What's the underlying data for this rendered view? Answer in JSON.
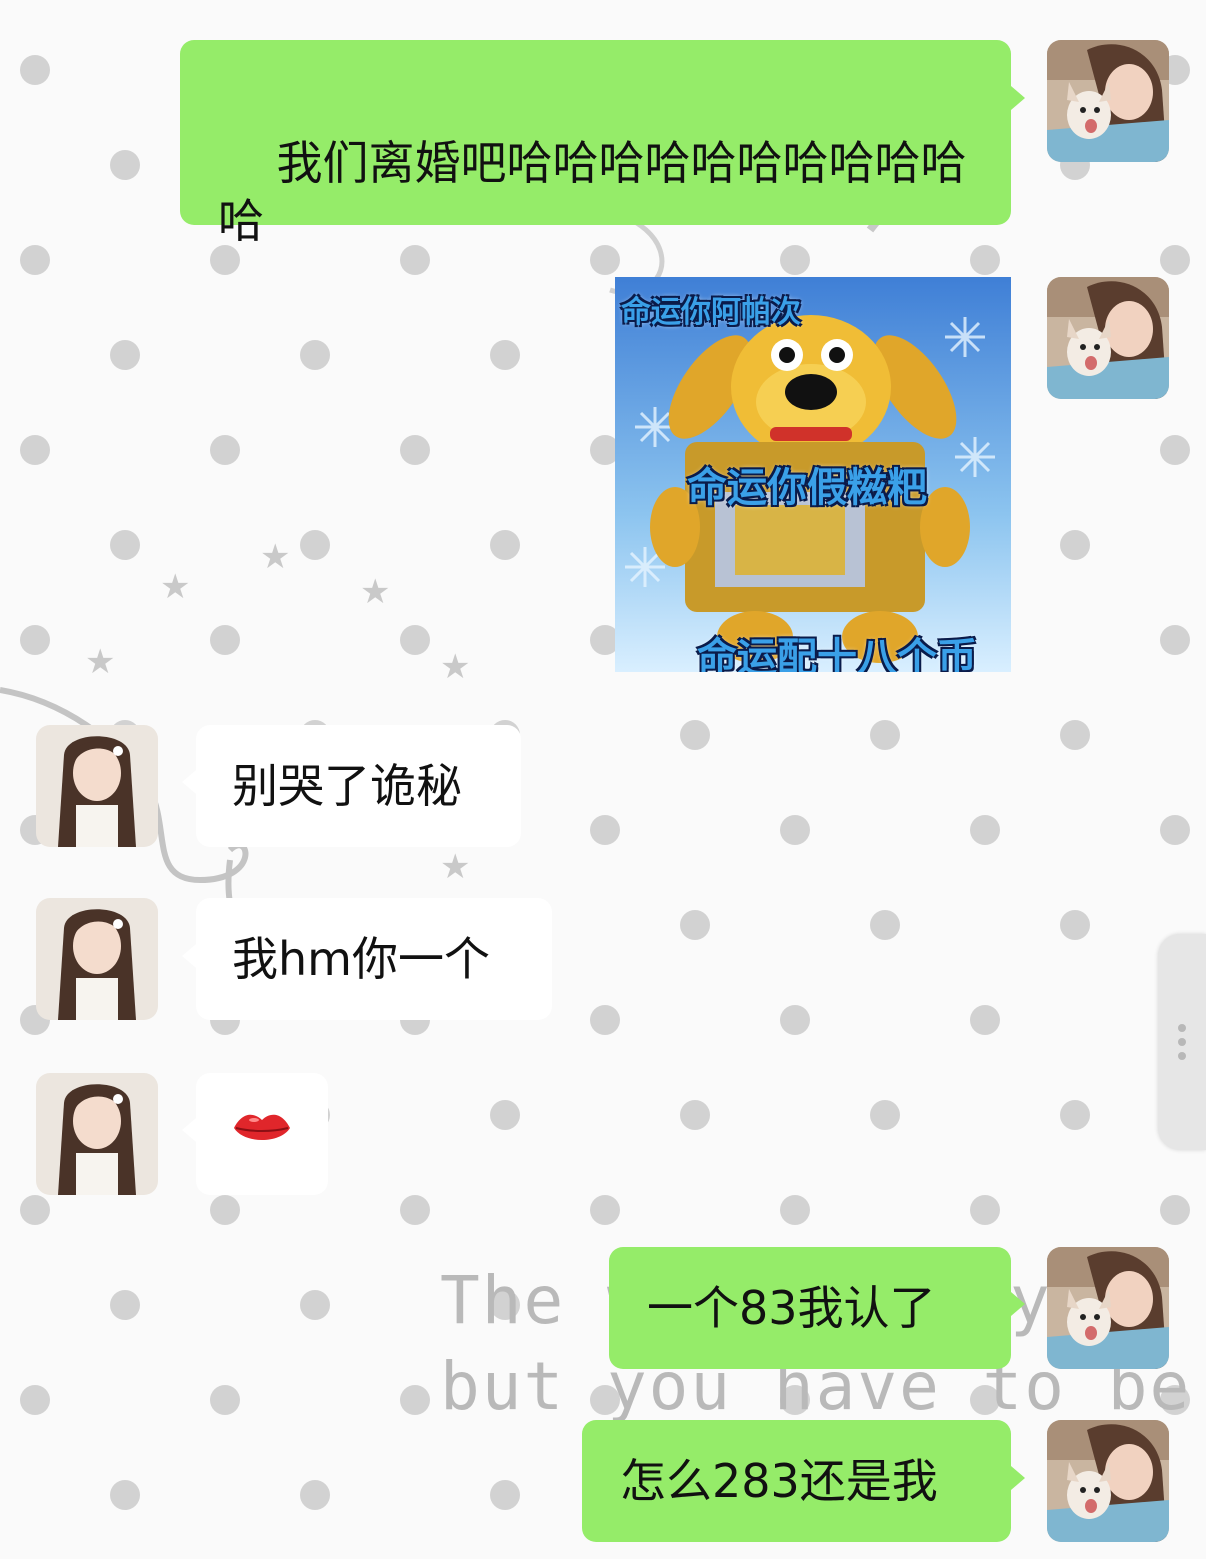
{
  "messages": [
    {
      "id": "m1",
      "side": "me",
      "type": "text",
      "text": "我们离婚吧哈哈哈哈哈哈哈哈哈哈\n哈"
    },
    {
      "id": "m2",
      "side": "me",
      "type": "sticker",
      "sticker": {
        "top_text": "命运你阿帕次",
        "middle_text": "命运你假糍粑",
        "bottom_text": "命运配十八个币"
      }
    },
    {
      "id": "m3",
      "side": "them",
      "type": "text",
      "text": "别哭了诡秘"
    },
    {
      "id": "m4",
      "side": "them",
      "type": "text",
      "text": "我hm你一个"
    },
    {
      "id": "m5",
      "side": "them",
      "type": "emoji",
      "text": "💋"
    },
    {
      "id": "m6",
      "side": "me",
      "type": "text",
      "text": "一个83我认了"
    },
    {
      "id": "m7",
      "side": "me",
      "type": "text",
      "text": "怎么283还是我"
    }
  ],
  "background": {
    "line1": "The w",
    "line1_tail": "y",
    "line2": "but you have to be cut"
  },
  "colors": {
    "my_bubble": "#95ec69",
    "their_bubble": "#ffffff",
    "chat_background": "#fafafa"
  },
  "icons": {
    "side_handle": "more-dots-icon"
  }
}
